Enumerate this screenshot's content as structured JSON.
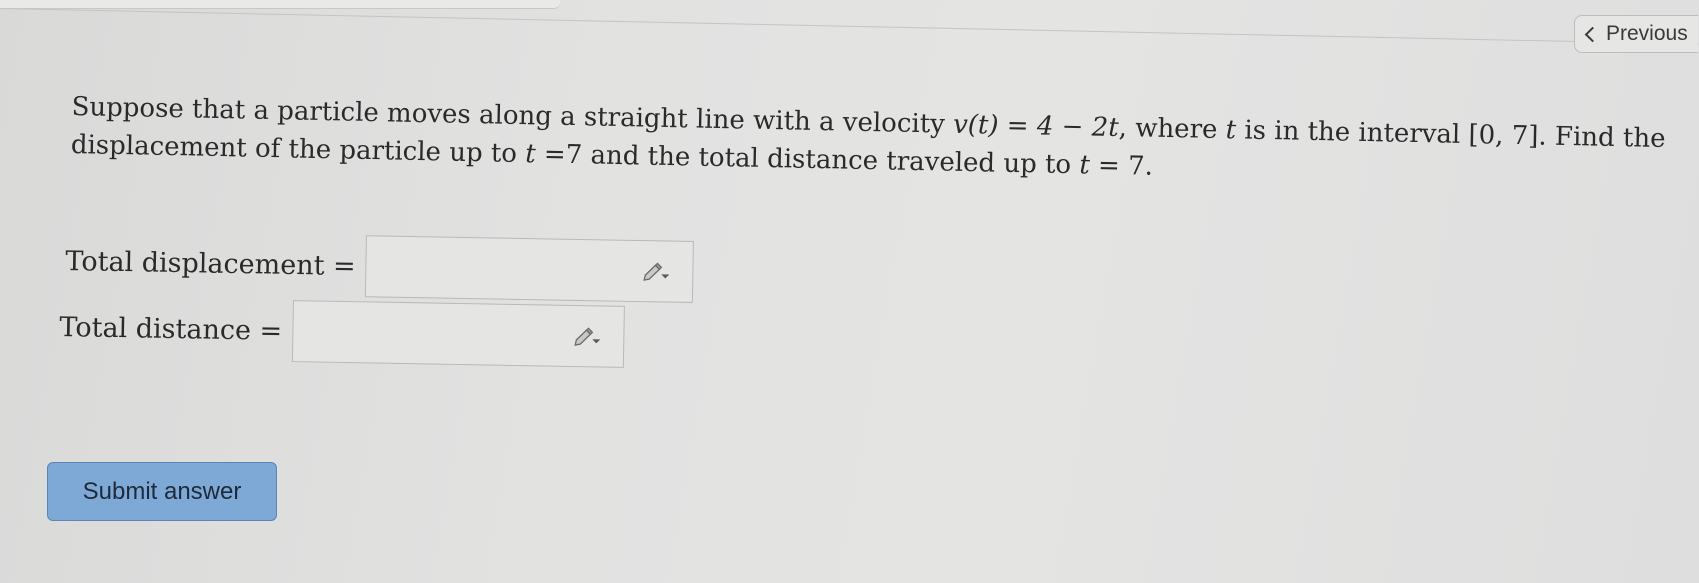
{
  "nav": {
    "previous_label": "Previous"
  },
  "question": {
    "line1": {
      "text_a": "Suppose that a particle moves along a straight line with a velocity ",
      "math_a": "v(t) = 4 − 2t",
      "text_b": ", where ",
      "math_b": "t",
      "text_c": " is in the interval ",
      "interval": "[0, 7]",
      "text_d": ". Find the"
    },
    "line2": {
      "text_a": "displacement of the particle up to ",
      "math_a": "t",
      "text_b": " =7 and the total distance traveled up to ",
      "math_b": "t",
      "text_c": " = 7."
    }
  },
  "answers": {
    "displacement_label": "Total displacement =",
    "displacement_value": "",
    "distance_label": "Total distance =",
    "distance_value": ""
  },
  "submit_label": "Submit answer",
  "colors": {
    "background": "#e2e2e1",
    "submit_button": "#7ea9d6",
    "text": "#2a2a2a"
  },
  "icons": {
    "answer_tool": "pencil-dropdown-icon",
    "previous": "chevron-left-icon"
  }
}
